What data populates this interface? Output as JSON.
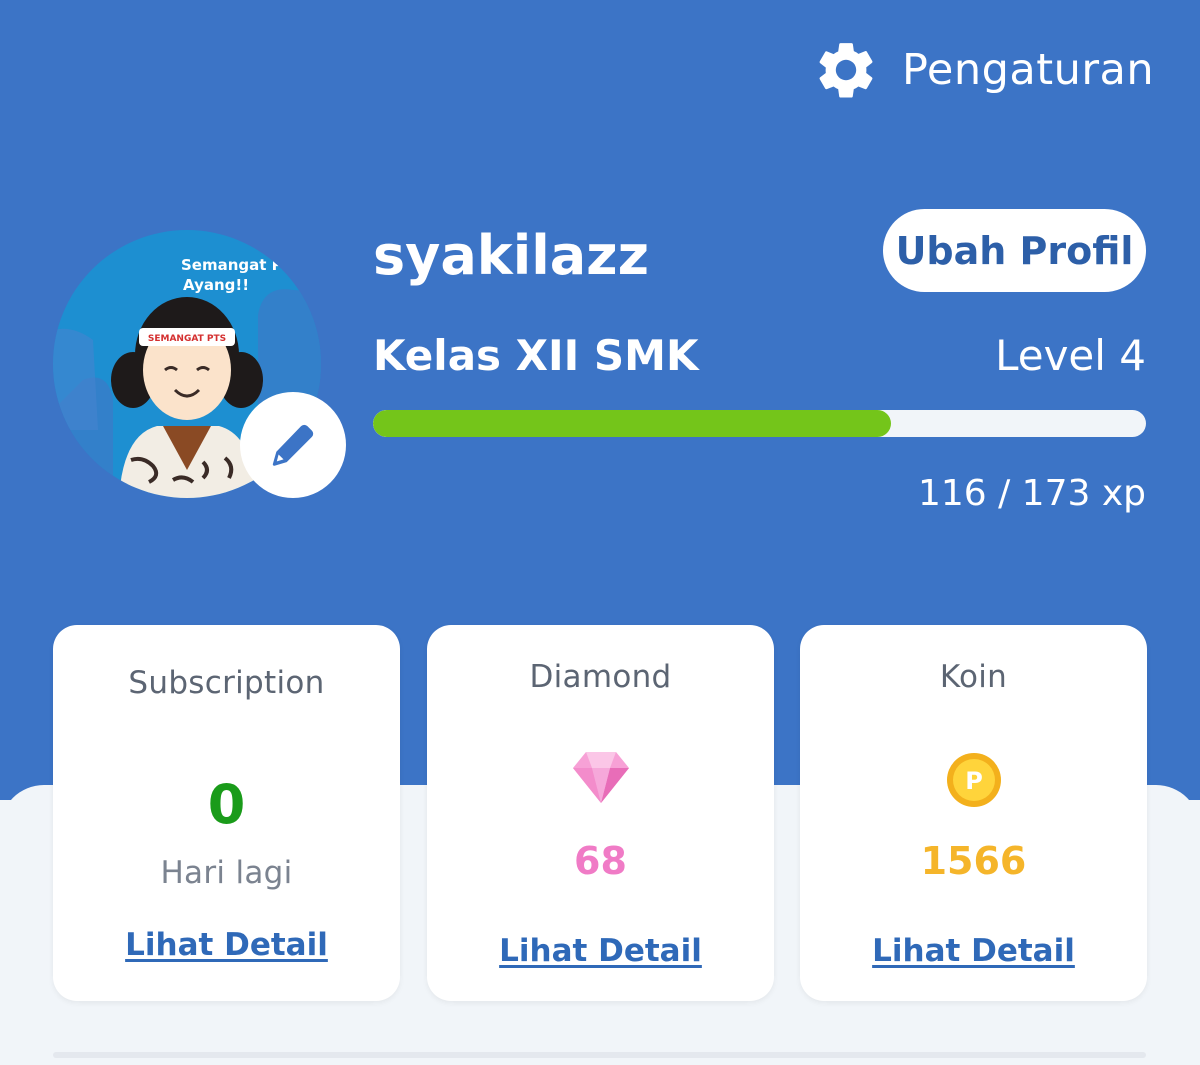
{
  "header": {
    "settings_label": "Pengaturan",
    "settings_icon": "gear-icon"
  },
  "profile": {
    "avatar_caption": [
      "Semangat P",
      "Ayang!!"
    ],
    "headband_text": "SEMANGAT PTS",
    "username": "syakilazz",
    "edit_profile_label": "Ubah Profil",
    "class_label": "Kelas XII SMK",
    "level_label": "Level 4",
    "xp_current": 116,
    "xp_max": 173,
    "xp_text": "116 / 173 xp",
    "edit_icon": "pencil-icon"
  },
  "cards": {
    "subscription": {
      "title": "Subscription",
      "value": "0",
      "subtitle": "Hari lagi",
      "link": "Lihat Detail",
      "value_color": "#1a9b1a"
    },
    "diamond": {
      "title": "Diamond",
      "value": "68",
      "link": "Lihat Detail",
      "icon": "diamond-icon",
      "value_color": "#f07bc6"
    },
    "coin": {
      "title": "Koin",
      "value": "1566",
      "link": "Lihat Detail",
      "icon": "coin-icon",
      "coin_letter": "P",
      "value_color": "#f5b52a"
    }
  },
  "colors": {
    "header_bg": "#3c74c6",
    "xp_fill": "#74c51a",
    "link": "#2f69b8"
  }
}
